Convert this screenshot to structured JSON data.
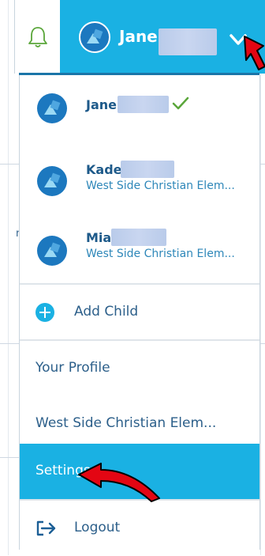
{
  "header": {
    "user_name": "Jane",
    "accent_color": "#1ab1e3",
    "icons": [
      "bell-icon",
      "avatar-icon",
      "chevron-down-icon"
    ]
  },
  "children": [
    {
      "name": "Jane",
      "school": "",
      "selected": true
    },
    {
      "name": "Kade",
      "school": "West Side Christian Elem...",
      "selected": false
    },
    {
      "name": "Mia",
      "school": "West Side Christian Elem...",
      "selected": false
    }
  ],
  "menu": {
    "add_child": "Add Child",
    "your_profile": "Your Profile",
    "school": "West Side Christian Elem...",
    "settings": "Settings",
    "logout": "Logout"
  },
  "colors": {
    "highlight": "#1ab1e3",
    "text": "#2c5f8a",
    "annotation_arrow": "#e30613"
  }
}
